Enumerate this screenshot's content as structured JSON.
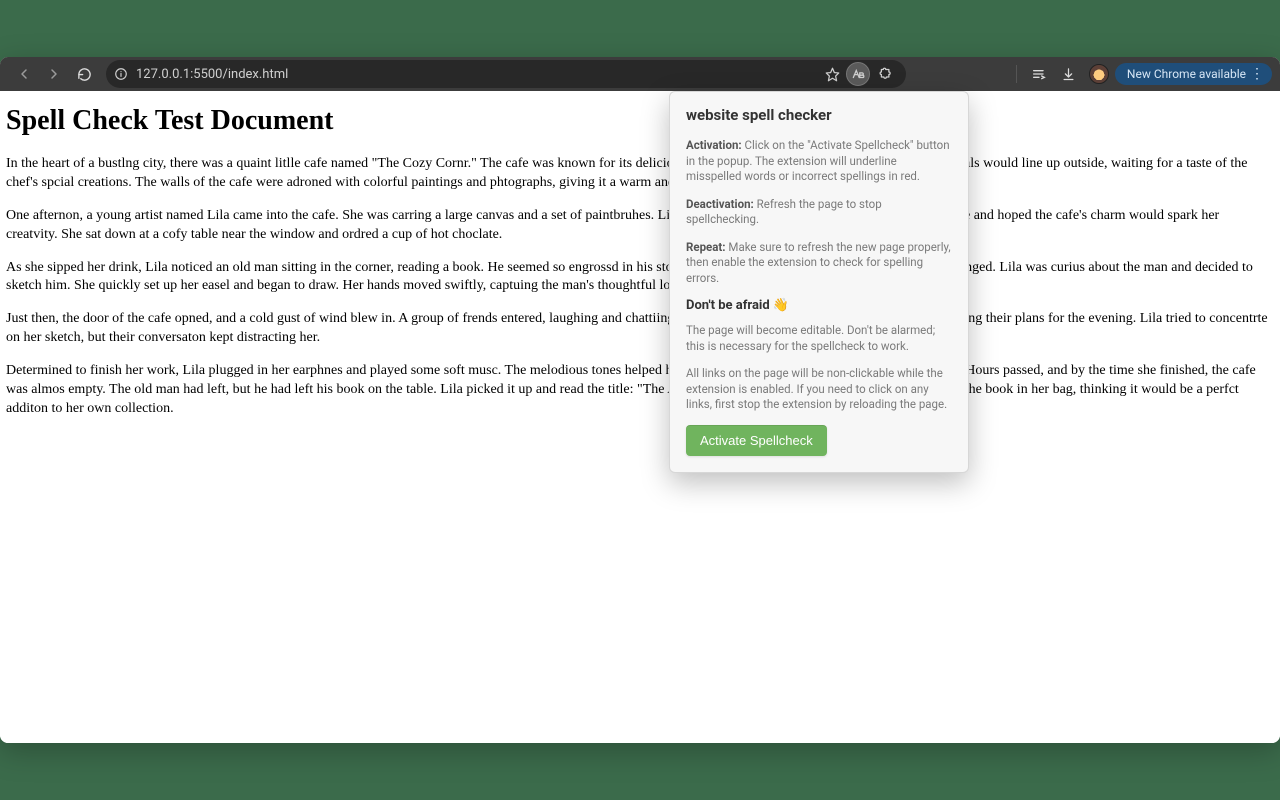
{
  "browser": {
    "url": "127.0.0.1:5500/index.html",
    "update_label": "New Chrome available"
  },
  "document": {
    "title": "Spell Check Test Document",
    "paragraphs": [
      "In the heart of a bustlng city, there was a quaint litlle cafe named \"The Cozy Cornr.\" The cafe was known for its delicious pasteries and aromatic cofee. Every morning, locals would line up outside, waiting for a taste of the chef's spcial creations. The walls of the cafe were adroned with colorful paintings and phtographs, giving it a warm and invting atmosphere.",
      "One afternon, a young artist named Lila came into the cafe. She was carring a large canvas and a set of paintbruhes. Lila was looking for inspration for her next masterpeice and hoped the cafe's charm would spark her creatvity. She sat down at a cofy table near the window and ordred a cup of hot choclate.",
      "As she sipped her drink, Lila noticed an old man sitting in the corner, reading a book. He seemed so engrossd in his story that he didn't notce the world around him had changed. Lila was curius about the man and decided to sketch him. She quickly set up her easel and began to draw. Her hands moved swiftly, captuing the man's thoughtful look.",
      "Just then, the door of the cafe opned, and a cold gust of wind blew in. A group of frends entered, laughing and chattiing loudly. They took a seat near Lila and began discusing their plans for the evening. Lila tried to concentrte on her sketch, but their conversaton kept distracting her.",
      "Determined to finish her work, Lila plugged in her earphnes and played some soft musc. The melodious tones helped her focus, and she continued to draw with preciision. Hours passed, and by the time she finished, the cafe was almos empty. The old man had left, but he had left his book on the table. Lila picked it up and read the title: \"The Adventres of a Wandering Soul.\" Intrigued, she took the book in her bag, thinking it would be a perfct additon to her own collection."
    ]
  },
  "extension": {
    "title": "website spell checker",
    "activation_label": "Activation:",
    "activation_text": " Click on the \"Activate Spellcheck\" button in the popup. The extension will underline misspelled words or incorrect spellings in red.",
    "deactivation_label": "Deactivation:",
    "deactivation_text": " Refresh the page to stop spellchecking.",
    "repeat_label": "Repeat:",
    "repeat_text": " Make sure to refresh the new page properly, then enable the extension to check for spelling errors.",
    "subheading": "Don't be afraid 👋",
    "note1": "The page will become editable. Don't be alarmed; this is necessary for the spellcheck to work.",
    "note2": "All links on the page will be non-clickable while the extension is enabled. If you need to click on any links, first stop the extension by reloading the page.",
    "button_label": "Activate Spellcheck"
  }
}
